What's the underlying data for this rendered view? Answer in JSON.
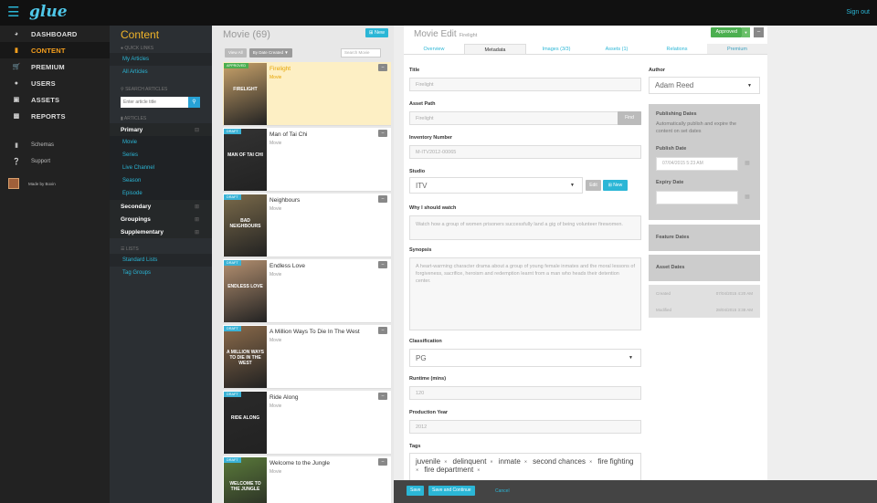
{
  "app": {
    "logo": "glue",
    "sign_out": "Sign out"
  },
  "sidebar": {
    "items": [
      {
        "label": "DASHBOARD",
        "icon": "dashboard-icon"
      },
      {
        "label": "CONTENT",
        "icon": "file-icon",
        "active": true
      },
      {
        "label": "PREMIUM",
        "icon": "cart-icon"
      },
      {
        "label": "USERS",
        "icon": "users-icon"
      },
      {
        "label": "ASSETS",
        "icon": "image-icon"
      },
      {
        "label": "REPORTS",
        "icon": "chart-icon"
      }
    ],
    "sub": [
      {
        "label": "Schemas",
        "icon": "doc-icon"
      },
      {
        "label": "Support",
        "icon": "question-icon"
      }
    ],
    "made_by": "Made by Boxin"
  },
  "content_panel": {
    "title": "Content",
    "quick_links_heading": "QUICK LINKS",
    "quick_links": [
      "My Articles",
      "All Articles"
    ],
    "search_heading": "SEARCH ARTICLES",
    "search_placeholder": "Enter article title",
    "articles_heading": "ARTICLES",
    "primary": "Primary",
    "primary_items": [
      "Movie",
      "Series",
      "Live Channel",
      "Season",
      "Episode"
    ],
    "secondary": "Secondary",
    "groupings": "Groupings",
    "supplementary": "Supplementary",
    "lists_heading": "LISTS",
    "lists": [
      "Standard Lists",
      "Tag Groups"
    ]
  },
  "list_panel": {
    "title": "Movie (69)",
    "new_label": "New",
    "view_all": "View All",
    "sort": "By Date Created",
    "search_placeholder": "Search Movie",
    "cards": [
      {
        "title": "Firelight",
        "type": "Movie",
        "status": "APPROVED",
        "poster_color": "#c8a26a",
        "poster_text": "FIRELIGHT"
      },
      {
        "title": "Man of Tai Chi",
        "type": "Movie",
        "status": "DRAFT",
        "poster_color": "#333333",
        "poster_text": "MAN OF TAI CHI"
      },
      {
        "title": "Neighbours",
        "type": "Movie",
        "status": "DRAFT",
        "poster_color": "#7a6a4a",
        "poster_text": "BAD NEIGHBOURS"
      },
      {
        "title": "Endless Love",
        "type": "Movie",
        "status": "DRAFT",
        "poster_color": "#b49070",
        "poster_text": "ENDLESS LOVE"
      },
      {
        "title": "A Million Ways To Die In The West",
        "type": "Movie",
        "status": "DRAFT",
        "poster_color": "#8a6a4a",
        "poster_text": "A MILLION WAYS TO DIE IN THE WEST"
      },
      {
        "title": "Ride Along",
        "type": "Movie",
        "status": "DRAFT",
        "poster_color": "#2a2a2a",
        "poster_text": "RIDE ALONG"
      },
      {
        "title": "Welcome to the Jungle",
        "type": "Movie",
        "status": "DRAFT",
        "poster_color": "#5a7a3a",
        "poster_text": "WELCOME TO THE JUNGLE"
      }
    ]
  },
  "edit": {
    "title": "Movie Edit",
    "subtitle": "Firelight",
    "status": "Approved",
    "tabs": [
      "Overview",
      "Metadata",
      "Images (3/3)",
      "Assets (1)",
      "Relations",
      "Premium"
    ],
    "title_label": "Title",
    "title_value": "Firelight",
    "asset_path_label": "Asset Path",
    "asset_path_value": "Firelight",
    "find_label": "Find",
    "inventory_label": "Inventory Number",
    "inventory_value": "M-ITV2012-00065",
    "studio_label": "Studio",
    "studio_value": "ITV",
    "edit_label": "Edit",
    "new_label": "New",
    "why_label": "Why I should watch",
    "why_value": "Watch how a group of women prisoners successfully land a gig of being volunteer firewomen.",
    "synopsis_label": "Synopsis",
    "synopsis_value": "A heart-warming character drama about a group of young female inmates and the moral lessons of forgiveness, sacrifice, heroism and redemption learnt from a man who heads their detention center.",
    "classification_label": "Classification",
    "classification_value": "PG",
    "runtime_label": "Runtime (mins)",
    "runtime_value": "120",
    "year_label": "Production Year",
    "year_value": "2012",
    "tags_label": "Tags",
    "tags": [
      "juvenile",
      "delinquent",
      "inmate",
      "second chances",
      "fire fighting",
      "fire department"
    ],
    "author_label": "Author",
    "author_value": "Adam Reed",
    "publishing_title": "Publishing Dates",
    "publishing_text": "Automatically publish and expire the content on set dates",
    "publish_date_label": "Publish Date",
    "publish_date_value": "07/04/2015 5:23 AM",
    "expiry_date_label": "Expiry Date",
    "feature_dates": "Feature Dates",
    "asset_dates": "Asset Dates",
    "created_label": "Created",
    "created_value": "07/04/2015 4:20 AM",
    "modified_label": "Modified",
    "modified_value": "28/04/2015 3:38 AM"
  },
  "footer": {
    "save": "Save",
    "save_continue": "Save and Continue",
    "cancel": "Cancel"
  }
}
